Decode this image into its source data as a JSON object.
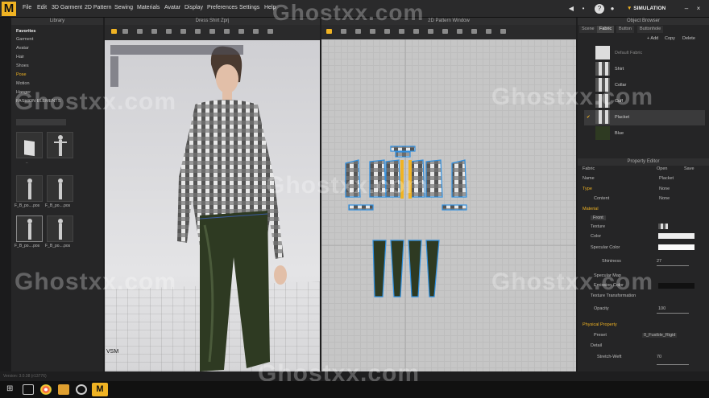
{
  "app": {
    "logo_letter": "M",
    "menu": [
      "File",
      "Edit",
      "3D Garment",
      "2D Pattern",
      "Sewing",
      "Materials",
      "Avatar",
      "Display",
      "Preferences",
      "Settings",
      "Help"
    ],
    "mode": "SIMULATION"
  },
  "watermark": "Ghostxx.com",
  "library": {
    "title": "Library",
    "favorites_label": "Favorites",
    "items": [
      "Garment",
      "Avatar",
      "Hair",
      "Shoes",
      "Pose",
      "Motion",
      "Hanger",
      "FASHION ELEMENTS"
    ],
    "active_item": "Pose",
    "thumbs": [
      "..",
      "F_B_po....pos",
      "F_B_po....pos",
      "F_B_po....pos",
      "F_B_po....pos",
      "F_B_po....pos"
    ]
  },
  "view3d": {
    "title": "Dress Shirt Zprj",
    "label": "VSM"
  },
  "view2d": {
    "title": "2D Pattern Window"
  },
  "object_browser": {
    "title": "Object Browser",
    "tabs": [
      "Scene",
      "Fabric",
      "Button",
      "Buttonhole"
    ],
    "actions": [
      "+ Add",
      "Copy",
      "Delete"
    ],
    "fabrics": [
      "Default Fabric",
      "Shirt",
      "Collar",
      "Cuff",
      "Placket",
      "Blue"
    ],
    "selected": "Placket"
  },
  "property_editor": {
    "title": "Property Editor",
    "fabric_label": "Fabric",
    "btn_open": "Open",
    "btn_save": "Save",
    "name_label": "Name",
    "name_value": "Placket",
    "type_label": "Type",
    "type_value": "None",
    "content_label": "Content",
    "content_value": "None",
    "material_label": "Material",
    "material_tabs": [
      "Front",
      "Back",
      "Side"
    ],
    "texture": "Texture",
    "color": "Color",
    "specular_color": "Specular Color",
    "shininess": "Shininess",
    "shininess_value": "27",
    "specular_map": "Specular Map",
    "emission_color": "Emission Color",
    "texture_transform": "Texture Transformation",
    "opacity": "Opacity",
    "opacity_value": "100",
    "physical": "Physical Property",
    "preset": "Preset",
    "preset_value": "0_Fusible_Rigid",
    "detail": "Detail",
    "stretch_weft": "Stretch-Weft",
    "stretch_weft_value": "70"
  },
  "status": "Version: 3.0.38 (r13776)",
  "colors": {
    "accent": "#f0b323",
    "fabric_dark": "#2e3a22"
  }
}
